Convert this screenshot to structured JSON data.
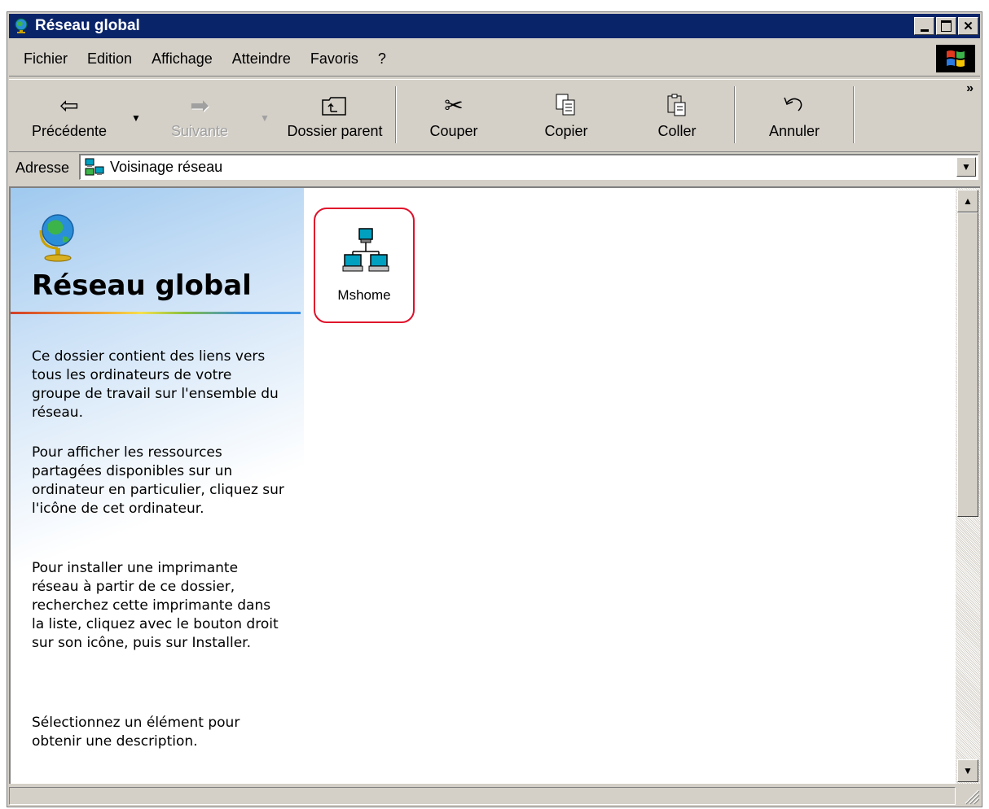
{
  "window": {
    "title": "Réseau global",
    "controls": [
      "minimize",
      "maximize",
      "close"
    ]
  },
  "menubar": {
    "items": [
      "Fichier",
      "Edition",
      "Affichage",
      "Atteindre",
      "Favoris",
      "?"
    ]
  },
  "toolbar": {
    "back_label": "Précédente",
    "forward_label": "Suivante",
    "parent_label": "Dossier parent",
    "cut_label": "Couper",
    "copy_label": "Copier",
    "paste_label": "Coller",
    "undo_label": "Annuler",
    "more_label": "»"
  },
  "address": {
    "label": "Adresse",
    "value": "Voisinage réseau"
  },
  "left_pane": {
    "title": "Réseau global",
    "paragraphs": [
      "Ce dossier contient des liens vers tous les ordinateurs de votre groupe de travail sur l'ensemble du réseau.",
      "Pour afficher les ressources partagées disponibles sur un ordinateur en particulier, cliquez sur l'icône de cet ordinateur.",
      "Pour installer une imprimante réseau à partir de ce dossier, recherchez cette imprimante dans la liste, cliquez avec le bouton droit sur son icône, puis sur Installer.",
      "Sélectionnez un élément pour obtenir une description."
    ]
  },
  "items": [
    {
      "label": "Mshome",
      "icon": "workgroup-network-icon"
    }
  ],
  "colors": {
    "titlebar": "#0a246a",
    "chrome": "#d4d0c8",
    "highlight_ring": "#e0102a"
  }
}
